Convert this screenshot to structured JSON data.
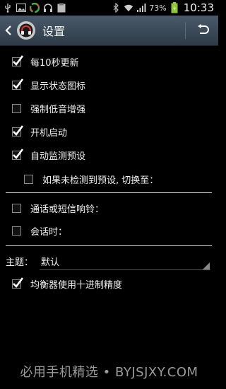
{
  "status_bar": {
    "left_icons": [
      "usb-icon",
      "image-icon",
      "color-wheel-icon",
      "headphones-icon",
      "clipboard-icon"
    ],
    "battery_percent": "73%",
    "time": "10:33"
  },
  "action_bar": {
    "title": "设置"
  },
  "settings": [
    {
      "label": "每10秒更新",
      "checked": true
    },
    {
      "label": "显示状态图标",
      "checked": true
    },
    {
      "label": "强制低音增强",
      "checked": false
    },
    {
      "label": "开机启动",
      "checked": true
    },
    {
      "label": "自动监测预设",
      "checked": true
    },
    {
      "label": "如果未检测到预设, 切换至：",
      "checked": false
    }
  ],
  "call_settings": [
    {
      "label": "通话或短信响铃：",
      "checked": false
    },
    {
      "label": "会话时：",
      "checked": false
    }
  ],
  "theme": {
    "label": "主题：",
    "value": "默认"
  },
  "decimal_precision": {
    "label": "均衡器使用十进制精度",
    "checked": true
  },
  "footer": {
    "watermark": "必用手机精选 • BYJSJXY.COM"
  },
  "colors": {
    "action_bar": "#3b4856",
    "background": "#000000",
    "accent": "#ffffff"
  }
}
